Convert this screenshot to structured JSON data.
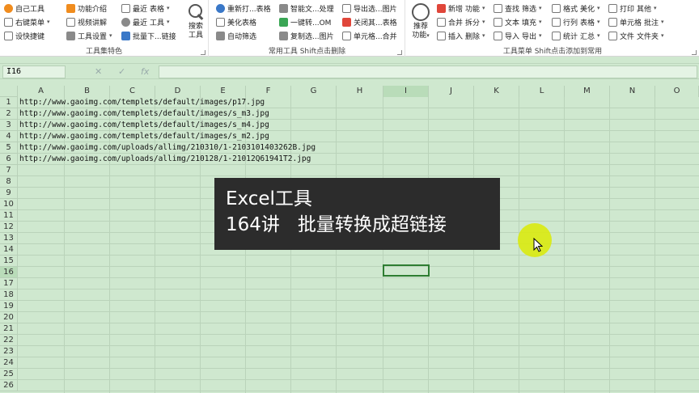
{
  "ribbon": {
    "group1": {
      "label": "工具集特色",
      "items": [
        "自己工具",
        "右键菜单",
        "设快捷键",
        "功能介绍",
        "视频讲解",
        "工具设置",
        "最近",
        "表格",
        "最近",
        "工具",
        "批量下...链接"
      ],
      "big_label_1": "搜索",
      "big_label_2": "工具"
    },
    "group2": {
      "label": "常用工具 Shift点击删除",
      "items": [
        "重新打...表格",
        "美化表格",
        "自动筛选",
        "智能文...处理",
        "一键转...OM",
        "复制选...图片",
        "导出选...图片",
        "关闭其...表格",
        "单元格...合并"
      ]
    },
    "group3": {
      "label": "工具菜单 Shift点击添加到常用",
      "big_label_1": "推荐",
      "big_label_2": "功能",
      "items": [
        "新增",
        "功能",
        "合并",
        "拆分",
        "插入",
        "删除",
        "查找",
        "筛选",
        "文本",
        "填充",
        "导入",
        "导出",
        "格式",
        "美化",
        "行列",
        "表格",
        "统计",
        "汇总",
        "打印",
        "其他",
        "单元格",
        "批注",
        "文件",
        "文件夹"
      ]
    }
  },
  "formula_bar": {
    "name_box": "I16",
    "cancel": "✕",
    "confirm": "✓",
    "fx": "fx",
    "content": ""
  },
  "columns": [
    "A",
    "B",
    "C",
    "D",
    "E",
    "F",
    "G",
    "H",
    "I",
    "J",
    "K",
    "L",
    "M",
    "N",
    "O"
  ],
  "rows": [
    "1",
    "2",
    "3",
    "4",
    "5",
    "6",
    "7",
    "8",
    "9",
    "10",
    "11",
    "12",
    "13",
    "14",
    "15",
    "16",
    "17",
    "18",
    "19",
    "20",
    "21",
    "22",
    "23",
    "24",
    "25",
    "26"
  ],
  "cells": [
    "http://www.gaoimg.com/templets/default/images/p17.jpg",
    "http://www.gaoimg.com/templets/default/images/s_m3.jpg",
    "http://www.gaoimg.com/templets/default/images/s_m4.jpg",
    "http://www.gaoimg.com/templets/default/images/s_m2.jpg",
    "http://www.gaoimg.com/uploads/allimg/210310/1-2103101403262B.jpg",
    "http://www.gaoimg.com/uploads/allimg/210128/1-21012Q61941T2.jpg"
  ],
  "overlay": {
    "line1": "Excel工具",
    "line2": "164讲   批量转换成超链接"
  }
}
